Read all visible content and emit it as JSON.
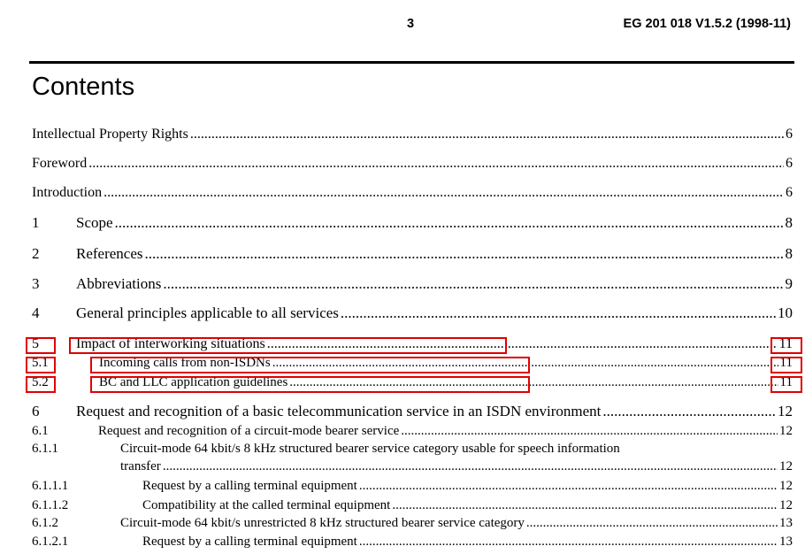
{
  "header": {
    "page_number": "3",
    "doc_id": "EG 201 018 V1.5.2 (1998-11)"
  },
  "title": "Contents",
  "toc": [
    {
      "num": "",
      "text": "Intellectual Property Rights",
      "page": "6"
    },
    {
      "num": "",
      "text": "Foreword",
      "page": "6"
    },
    {
      "num": "",
      "text": "Introduction",
      "page": "6"
    },
    {
      "num": "1",
      "text": "Scope",
      "page": "8"
    },
    {
      "num": "2",
      "text": "References",
      "page": "8"
    },
    {
      "num": "3",
      "text": "Abbreviations",
      "page": "9"
    },
    {
      "num": "4",
      "text": "General principles applicable to all services",
      "page": "10"
    },
    {
      "num": "5",
      "text": "Impact of interworking situations",
      "page": "11"
    },
    {
      "num": "5.1",
      "text": "Incoming calls from non-ISDNs",
      "page": "11"
    },
    {
      "num": "5.2",
      "text": "BC and LLC application guidelines",
      "page": "11"
    },
    {
      "num": "6",
      "text": "Request and recognition of a basic telecommunication service in an ISDN environment",
      "page": "12"
    },
    {
      "num": "6.1",
      "text": "Request and recognition of a circuit-mode bearer service",
      "page": "12"
    },
    {
      "num": "6.1.1",
      "text": "Circuit-mode 64 kbit/s 8 kHz structured bearer service category usable for speech information",
      "text2": "transfer",
      "page": "12"
    },
    {
      "num": "6.1.1.1",
      "text": "Request by a calling terminal equipment",
      "page": "12"
    },
    {
      "num": "6.1.1.2",
      "text": "Compatibility at the called terminal equipment",
      "page": "12"
    },
    {
      "num": "6.1.2",
      "text": "Circuit-mode 64 kbit/s unrestricted 8 kHz structured bearer service category",
      "page": "13"
    },
    {
      "num": "6.1.2.1",
      "text": "Request by a calling terminal equipment",
      "page": "13"
    }
  ],
  "highlight_color": "#e00000"
}
